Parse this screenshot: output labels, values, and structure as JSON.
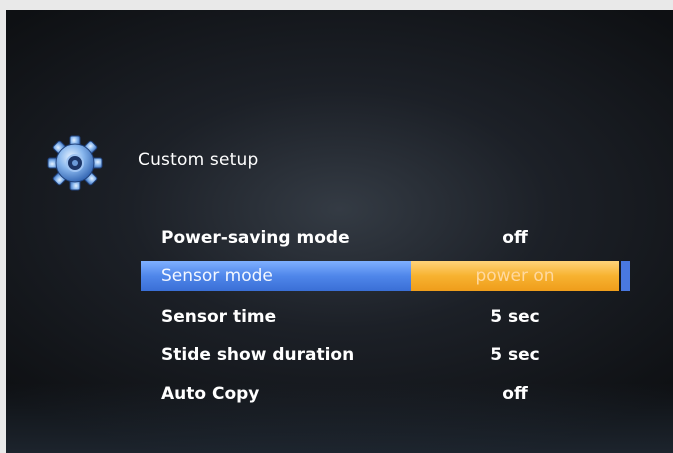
{
  "header": {
    "title": "Custom setup",
    "icon": "gear-icon"
  },
  "colors": {
    "highlight_blue": "#4f86ea",
    "highlight_orange": "#f7b230"
  },
  "menu": {
    "items": [
      {
        "label": "Power-saving mode",
        "value": "off"
      },
      {
        "label": "Sensor mode",
        "value": "power on",
        "selected": true
      },
      {
        "label": "Sensor time",
        "value": "5 sec"
      },
      {
        "label": "Stide show duration",
        "value": "5 sec"
      },
      {
        "label": "Auto Copy",
        "value": "off"
      }
    ]
  }
}
